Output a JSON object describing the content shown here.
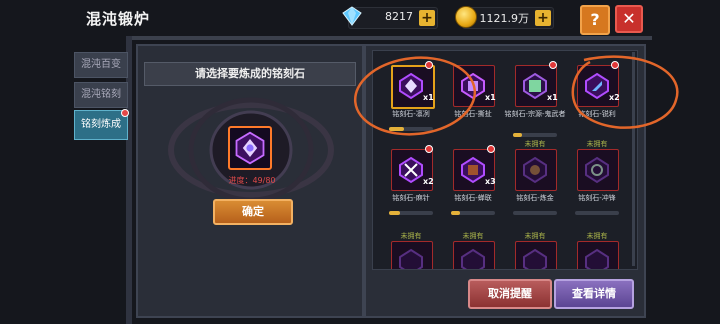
{
  "header": {
    "title": "混沌锻炉"
  },
  "currency": {
    "gems": "8217",
    "gold": "1121.9万",
    "plus": "+"
  },
  "buttons": {
    "help": "?",
    "close": "✕"
  },
  "side_tabs": [
    {
      "label": "混沌百变",
      "active": false
    },
    {
      "label": "混沌铭刻",
      "active": false
    },
    {
      "label": "铭刻炼成",
      "active": true
    }
  ],
  "left": {
    "header": "请选择要炼成的铭刻石",
    "progress": "进度：49/80",
    "confirm": "确定"
  },
  "cards_row1": [
    {
      "label": "铭刻石-凛冽",
      "qty": "x1",
      "color": "#b04cff",
      "selected": true
    },
    {
      "label": "铭刻石-撕扯",
      "qty": "x1",
      "color": "#c65bff",
      "selected": false
    },
    {
      "label": "铭刻石-宗源-鬼武者",
      "qty": "x1",
      "color": "#7fd6a0",
      "selected": false
    },
    {
      "label": "铭刻石-锐利",
      "qty": "x2",
      "color": "#6fb6ff",
      "selected": false
    }
  ],
  "cards_row2": [
    {
      "label": "铭刻石-麻针",
      "qty": "x2",
      "owned": "",
      "progress": 0.25
    },
    {
      "label": "铭刻石-蝉联",
      "qty": "x3",
      "owned": "",
      "progress": 0.2
    },
    {
      "label": "铭刻石-炼金",
      "qty": "",
      "owned": "未拥有",
      "progress": 0
    },
    {
      "label": "铭刻石-冲锋",
      "qty": "",
      "owned": "未拥有",
      "progress": 0
    }
  ],
  "cards_row3": [
    {
      "owned": "未拥有"
    },
    {
      "owned": "未拥有"
    },
    {
      "owned": "未拥有"
    },
    {
      "owned": "未拥有"
    }
  ],
  "row1_progress": [
    0.35,
    0.0,
    0.2,
    0.0
  ],
  "bottom": {
    "cancel": "取消提醒",
    "details": "查看详情"
  }
}
